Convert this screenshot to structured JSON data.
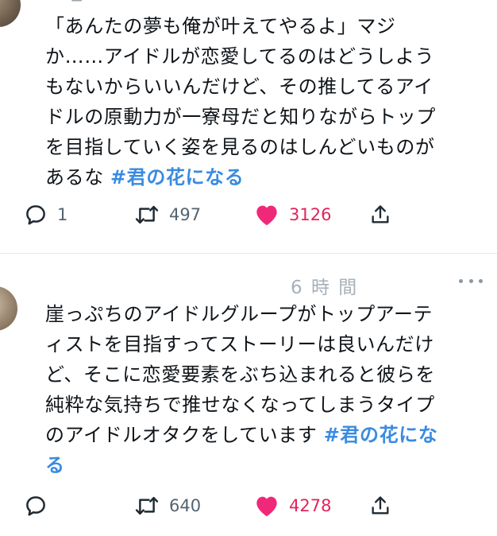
{
  "tweets": [
    {
      "header": "@ _",
      "lines": [
        "「あんたの夢も俺が叶えてやるよ」マジ",
        "か……アイドルが恋愛してるのはどうしよう",
        "もないからいいんだけど、その推してるアイ",
        "ドルの原動力が一寮母だと知りながらトップ",
        "を目指していく姿を見るのはしんどいものが"
      ],
      "last_line_text": "あるな ",
      "hashtag": "#君の花になる",
      "reply_count": "1",
      "retweet_count": "497",
      "like_count": "3126"
    },
    {
      "header": "6 時 間",
      "lines": [
        "崖っぷちのアイドルグループがトップアーテ",
        "ィストを目指すってストーリーは良いんだけ",
        "ど、そこに恋愛要素をぶち込まれると彼らを",
        "純粋な気持ちで推せなくなってしまうタイプ"
      ],
      "last_line_text": "のアイドルオタクをしています ",
      "hashtag_part1": "#君の花にな",
      "hashtag_part2": "る",
      "reply_count": "",
      "retweet_count": "640",
      "like_count": "4278"
    }
  ],
  "icons": {
    "reply": "reply-icon",
    "retweet": "retweet-icon",
    "like": "heart-icon",
    "share": "share-icon",
    "more": "more-icon"
  },
  "colors": {
    "text": "#0f1419",
    "muted": "#536471",
    "hashtag": "#3a8be0",
    "like": "#e0245e",
    "divider": "#e4e8eb"
  }
}
